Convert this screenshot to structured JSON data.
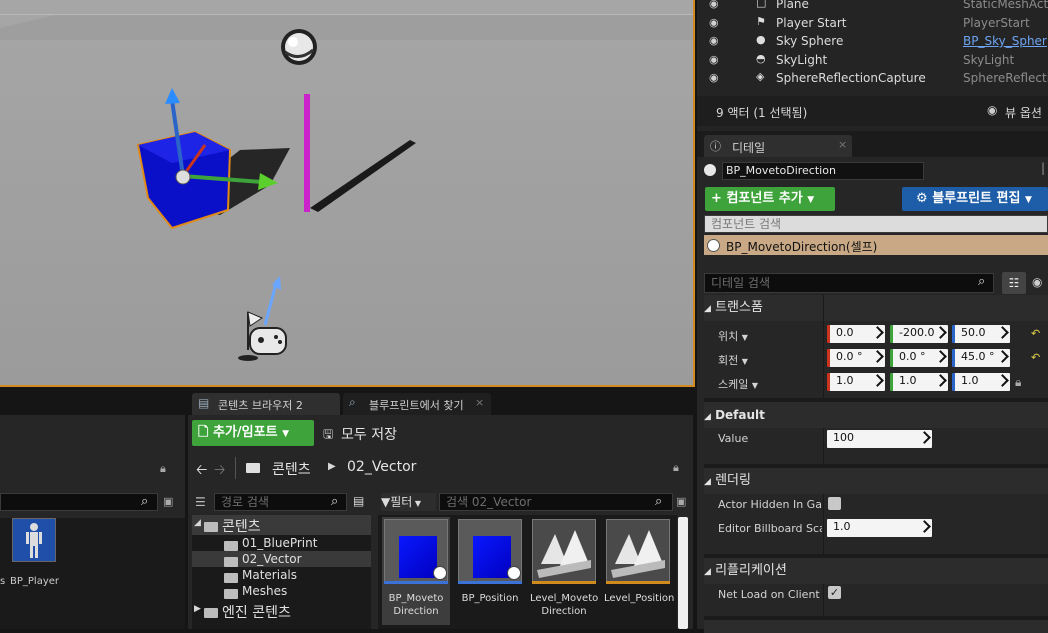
{
  "outliner": {
    "rows": [
      {
        "name": "Plane",
        "type": "StaticMeshActo"
      },
      {
        "name": "Player Start",
        "type": "PlayerStart"
      },
      {
        "name": "Sky Sphere",
        "type": "BP_Sky_Spher"
      },
      {
        "name": "SkyLight",
        "type": "SkyLight"
      },
      {
        "name": "SphereReflectionCapture",
        "type": "SphereReflectio"
      }
    ],
    "count": "9 액터 (1 선택됨)",
    "view_options": "뷰 옵션"
  },
  "details": {
    "tab_label": "디테일",
    "actor_name": "BP_MovetoDirection",
    "add_component": "컴포넌트 추가",
    "edit_blueprint": "블루프린트 편집",
    "component_search_placeholder": "컴포넌트 검색",
    "root_component": "BP_MovetoDirection(셀프)",
    "details_search_placeholder": "디테일 검색",
    "transform_section": "트랜스폼",
    "location_label": "위치",
    "rotation_label": "회전",
    "scale_label": "스케일",
    "location": [
      "0.0",
      "-200.0",
      "50.0"
    ],
    "rotation": [
      "0.0 °",
      "0.0 °",
      "45.0 °"
    ],
    "scale": [
      "1.0",
      "1.0",
      "1.0"
    ],
    "default_section": "Default",
    "value_label": "Value",
    "value": "100",
    "rendering_section": "렌더링",
    "actor_hidden_label": "Actor Hidden In Game",
    "editor_billboard_label": "Editor Billboard Scale",
    "editor_billboard_value": "1.0",
    "replication_section": "리플리케이션",
    "net_load_label": "Net Load on Client"
  },
  "content_browser": {
    "tab1": "콘텐츠 브라우저 2",
    "tab2": "블루프린트에서 찾기",
    "add_import": "추가/임포트",
    "save_all": "모두 저장",
    "path_root": "콘텐츠",
    "path_folder": "02_Vector",
    "path_search_placeholder": "경로 검색",
    "filter_label": "필터",
    "asset_search_placeholder": "검색 02_Vector",
    "tree": [
      "콘텐츠",
      "01_BluePrint",
      "02_Vector",
      "Materials",
      "Meshes",
      "엔진 콘텐츠"
    ],
    "assets": [
      {
        "label1": "BP_Moveto",
        "label2": "Direction"
      },
      {
        "label1": "BP_Position",
        "label2": ""
      },
      {
        "label1": "Level_Moveto",
        "label2": "Direction"
      },
      {
        "label1": "Level_Position",
        "label2": ""
      }
    ],
    "left_asset_label": "BP_Player",
    "left_asset_label_cut": "s"
  },
  "colors": {
    "accent_orange": "#d08a1d",
    "green_button": "#3ea33a",
    "blue_button": "#1e5ea8",
    "selected_row": "#c9a985",
    "x_axis": "#c8341e",
    "y_axis": "#3ea33a",
    "z_axis": "#2a64c8"
  }
}
